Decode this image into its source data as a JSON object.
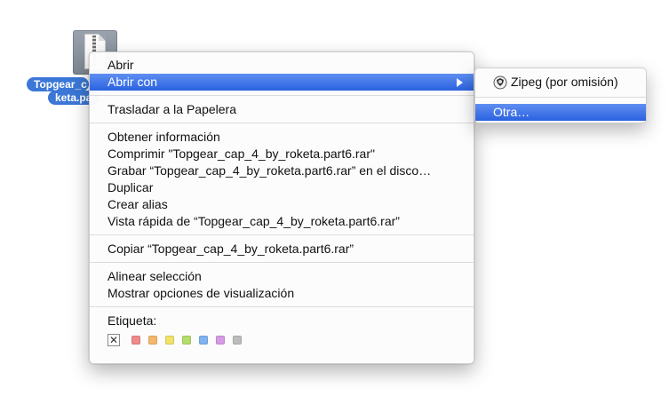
{
  "desktop": {
    "file_label_line1": "Topgear_c",
    "file_label_line2": "keta.pa"
  },
  "context_menu": {
    "open": "Abrir",
    "open_with": "Abrir con",
    "move_to_trash": "Trasladar a la Papelera",
    "get_info": "Obtener información",
    "compress": "Comprimir \"Topgear_cap_4_by_roketa.part6.rar\"",
    "burn": "Grabar “Topgear_cap_4_by_roketa.part6.rar” en el disco…",
    "duplicate": "Duplicar",
    "make_alias": "Crear alias",
    "quick_look": "Vista rápida de “Topgear_cap_4_by_roketa.part6.rar”",
    "copy": "Copiar “Topgear_cap_4_by_roketa.part6.rar”",
    "align_selection": "Alinear selección",
    "show_view_options": "Mostrar opciones de visualización",
    "label_heading": "Etiqueta:",
    "label_none": "✕",
    "label_colors": [
      "#f08a8a",
      "#f5b86a",
      "#f0e36a",
      "#b5dd6a",
      "#7fb3f0",
      "#d59ae6",
      "#bdbdbd"
    ]
  },
  "open_with_submenu": {
    "default_app": "Zipeg (por omisión)",
    "other": "Otra…"
  },
  "colors": {
    "highlight": "#2a62e0",
    "selection_label": "#3b77d6"
  }
}
